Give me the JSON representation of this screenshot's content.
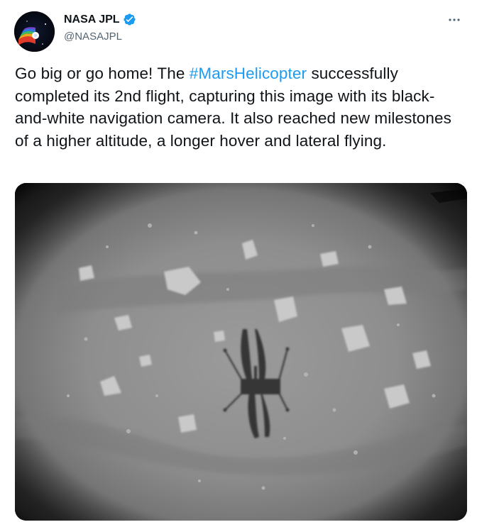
{
  "author": {
    "display_name": "NASA JPL",
    "handle": "@NASAJPL",
    "verified": true,
    "avatar_icon": "nasa-jpl-logo-icon"
  },
  "tweet": {
    "text_before": "Go big or go home! The ",
    "hashtag": "#MarsHelicopter",
    "text_after": " successfully completed its 2nd flight, capturing this image with its black-and-white navigation camera. It also reached new milestones of a higher altitude, a longer hover and lateral flying."
  },
  "media": {
    "type": "photo",
    "style": "black-and-white"
  },
  "colors": {
    "link": "#1d9bf0",
    "verified_badge": "#1d9bf0",
    "secondary_text": "#536471",
    "primary_text": "#0f1419"
  },
  "icons": {
    "more": "more-options-icon",
    "verified": "verified-badge-icon"
  }
}
